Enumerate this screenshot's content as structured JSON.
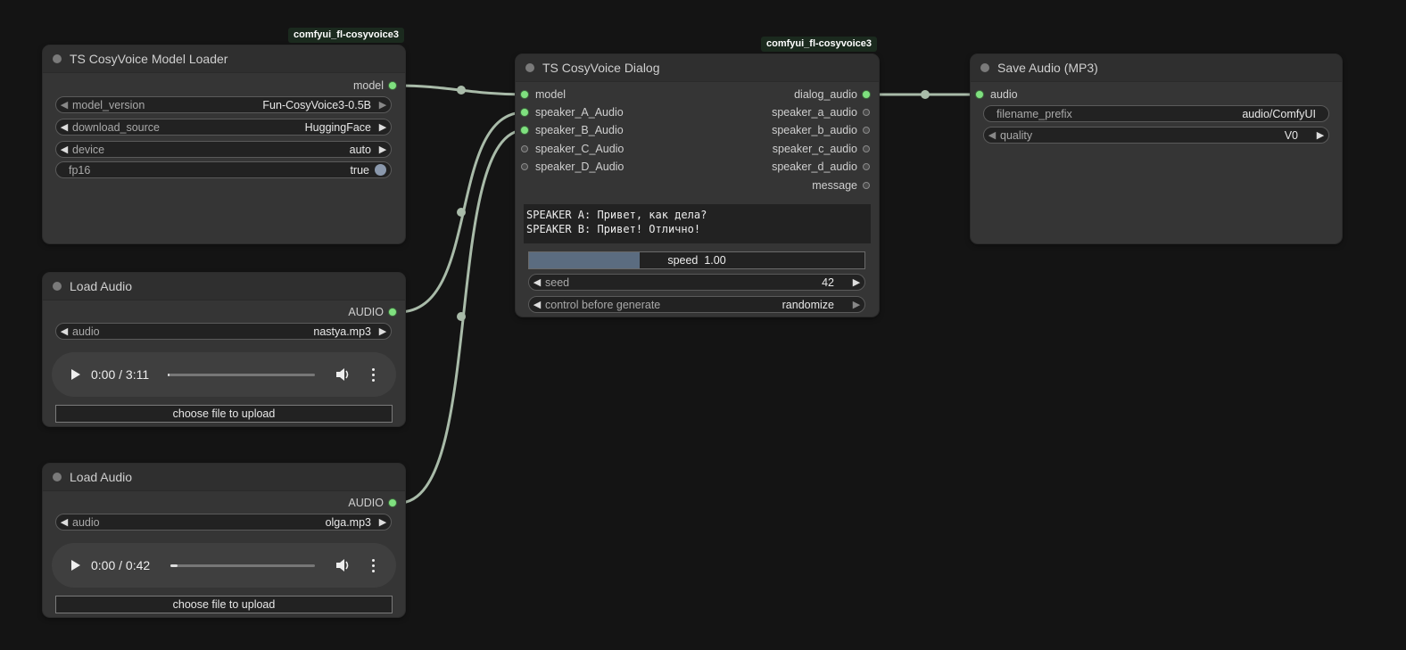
{
  "badges": {
    "loader": "comfyui_fl-cosyvoice3",
    "dialog": "comfyui_fl-cosyvoice3"
  },
  "loader": {
    "title": "TS CosyVoice Model Loader",
    "output": "model",
    "widgets": {
      "model_version": {
        "label": "model_version",
        "value": "Fun-CosyVoice3-0.5B"
      },
      "download_source": {
        "label": "download_source",
        "value": "HuggingFace"
      },
      "device": {
        "label": "device",
        "value": "auto"
      },
      "fp16": {
        "label": "fp16",
        "value": "true"
      }
    }
  },
  "load1": {
    "title": "Load Audio",
    "output": "AUDIO",
    "audio": {
      "label": "audio",
      "value": "nastya.mp3"
    },
    "player": {
      "time": "0:00 / 3:11",
      "progress": 0.01
    },
    "upload": "choose file to upload"
  },
  "load2": {
    "title": "Load Audio",
    "output": "AUDIO",
    "audio": {
      "label": "audio",
      "value": "olga.mp3"
    },
    "player": {
      "time": "0:00 / 0:42",
      "progress": 0.05
    },
    "upload": "choose file to upload"
  },
  "dialog": {
    "title": "TS CosyVoice Dialog",
    "inputs": [
      "model",
      "speaker_A_Audio",
      "speaker_B_Audio",
      "speaker_C_Audio",
      "speaker_D_Audio"
    ],
    "outputs": [
      "dialog_audio",
      "speaker_a_audio",
      "speaker_b_audio",
      "speaker_c_audio",
      "speaker_d_audio",
      "message"
    ],
    "text": "SPEAKER A: Привет, как дела?\nSPEAKER B: Привет! Отлично!",
    "speed": {
      "label": "speed",
      "value": "1.00",
      "fill": 0.33
    },
    "seed": {
      "label": "seed",
      "value": "42"
    },
    "control": {
      "label": "control before generate",
      "value": "randomize"
    }
  },
  "save": {
    "title": "Save Audio (MP3)",
    "input": "audio",
    "filename_prefix": {
      "label": "filename_prefix",
      "value": "audio/ComfyUI"
    },
    "quality": {
      "label": "quality",
      "value": "V0"
    }
  },
  "colors": {
    "wire": "#a9bba9",
    "slot_on": "#7fe07f",
    "node_bg": "#353535",
    "canvas": "#141414"
  }
}
